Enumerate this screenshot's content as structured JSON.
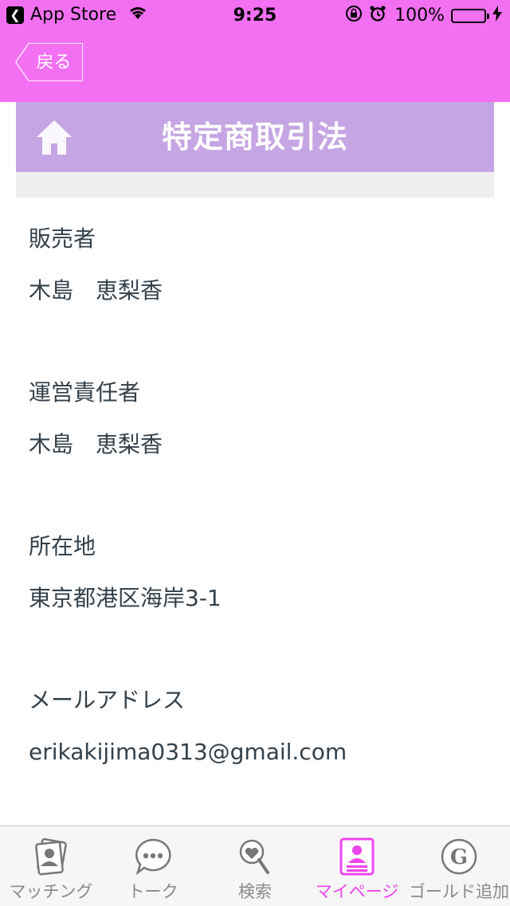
{
  "status_bar": {
    "back_app": "App Store",
    "time": "9:25",
    "battery": "100%"
  },
  "nav": {
    "back_label": "戻る",
    "title": "特定商取引法"
  },
  "sections": [
    {
      "label": "販売者",
      "value": "木島　恵梨香"
    },
    {
      "label": "運営責任者",
      "value": "木島　恵梨香"
    },
    {
      "label": "所在地",
      "value": "東京都港区海岸3-1"
    },
    {
      "label": "メールアドレス",
      "value": "erikakijima0313@gmail.com"
    }
  ],
  "tabs": [
    {
      "label": "マッチング",
      "icon": "matching-icon",
      "active": false
    },
    {
      "label": "トーク",
      "icon": "talk-icon",
      "active": false
    },
    {
      "label": "検索",
      "icon": "search-icon",
      "active": false
    },
    {
      "label": "マイページ",
      "icon": "mypage-icon",
      "active": true
    },
    {
      "label": "ゴールド追加",
      "icon": "gold-icon",
      "active": false
    }
  ],
  "colors": {
    "header": "#f370f3",
    "title_band": "#c5a5e3",
    "active_tab": "#ee44ee"
  }
}
